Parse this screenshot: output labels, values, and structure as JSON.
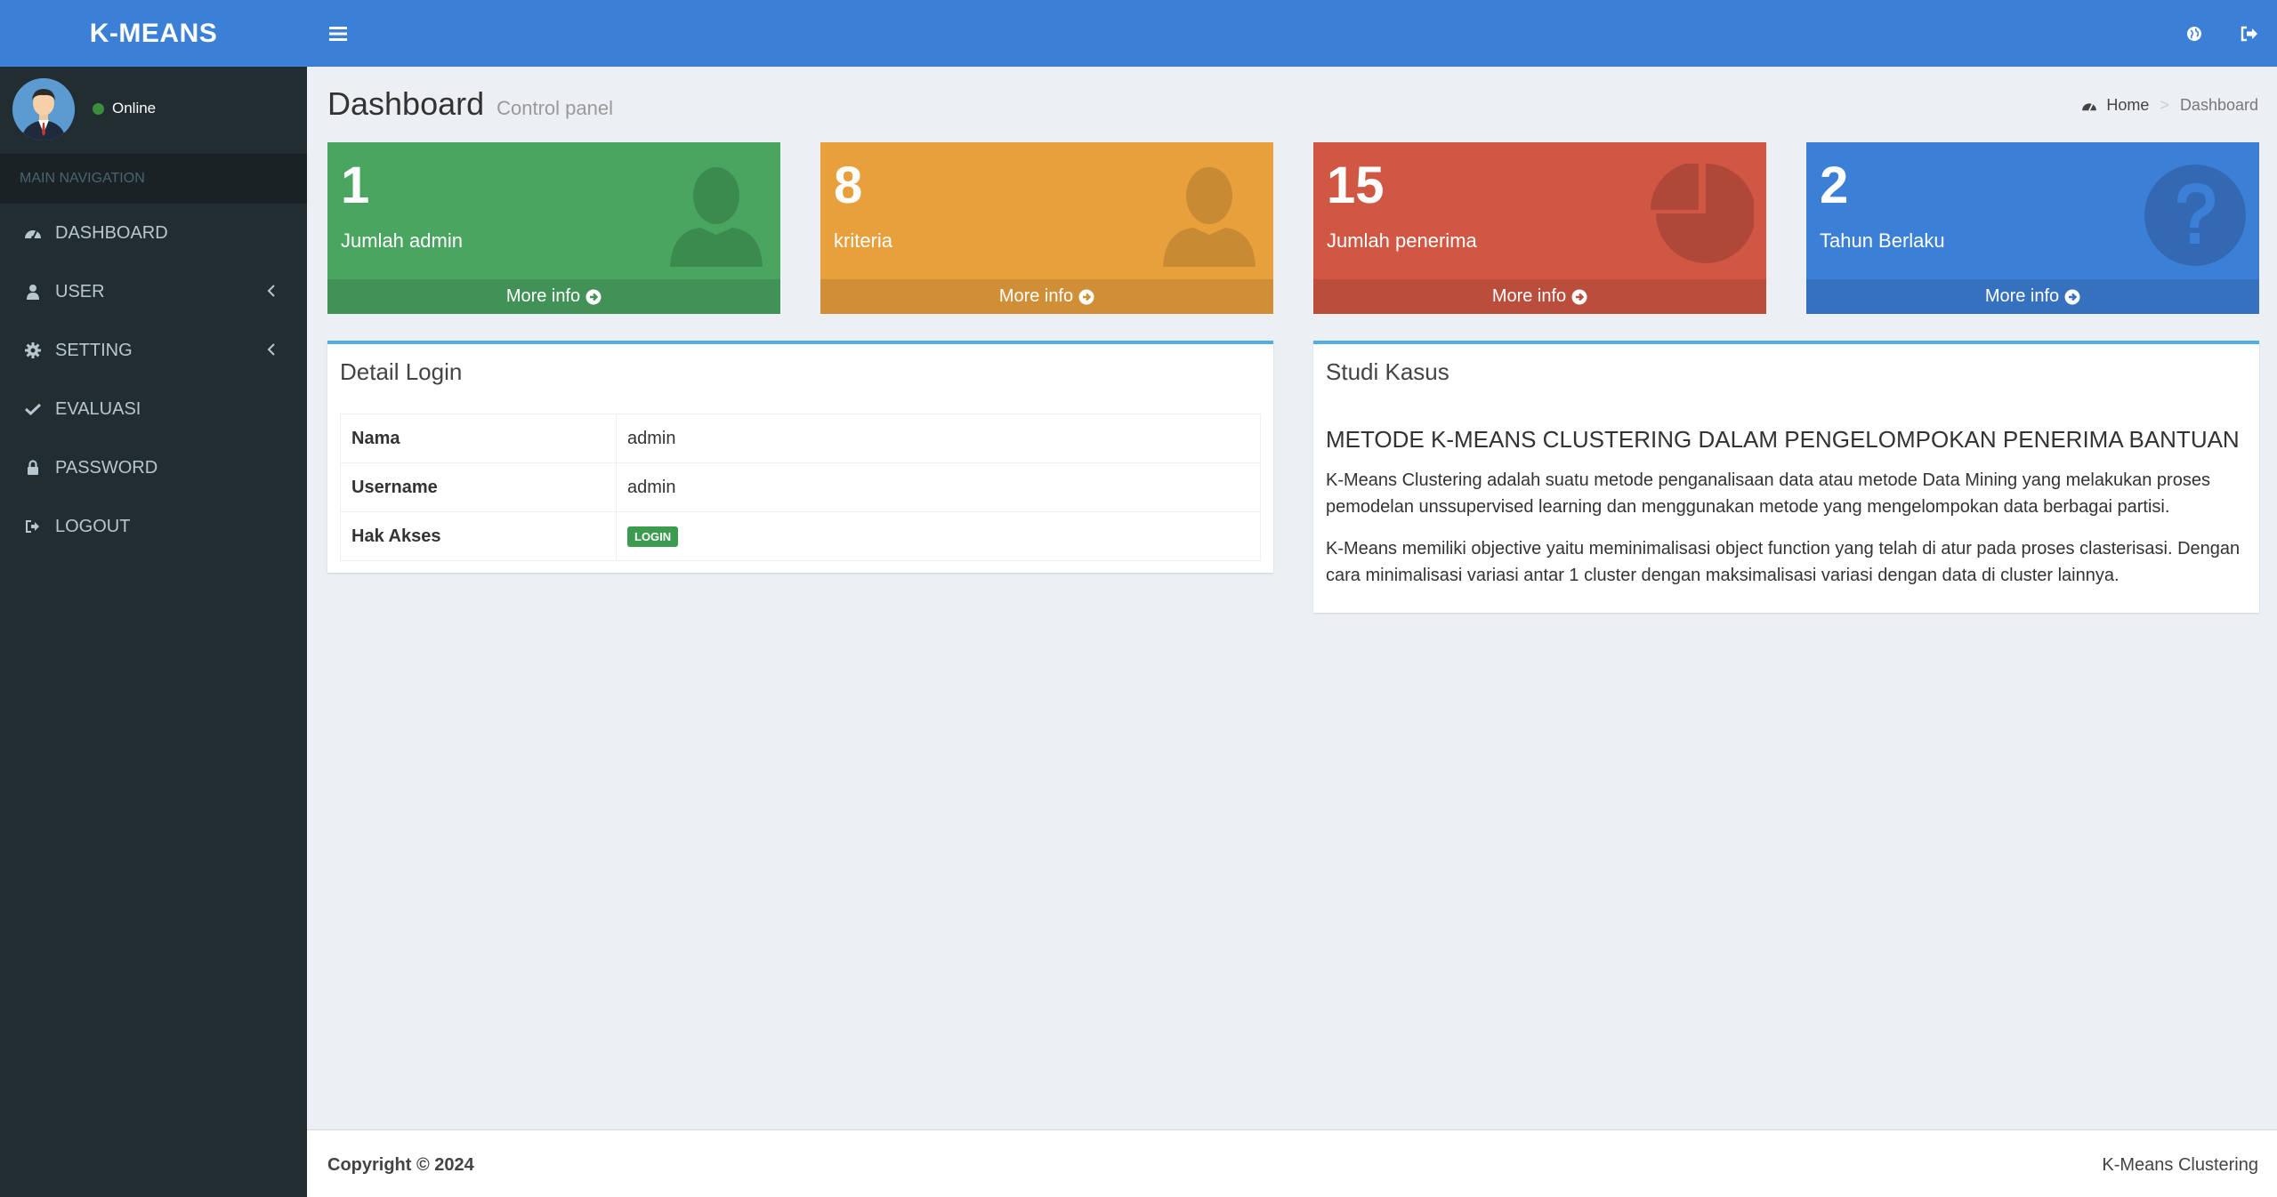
{
  "app": {
    "logo": "K-MEANS"
  },
  "user": {
    "status": "Online"
  },
  "sidebar": {
    "header": "MAIN NAVIGATION",
    "items": [
      {
        "label": "DASHBOARD",
        "icon": "dashboard-icon"
      },
      {
        "label": "USER",
        "icon": "user-icon"
      },
      {
        "label": "SETTING",
        "icon": "gear-icon"
      },
      {
        "label": "EVALUASI",
        "icon": "check-icon"
      },
      {
        "label": "PASSWORD",
        "icon": "lock-icon"
      },
      {
        "label": "LOGOUT",
        "icon": "logout-icon"
      }
    ]
  },
  "page": {
    "title": "Dashboard",
    "subtitle": "Control panel"
  },
  "breadcrumb": {
    "home": "Home",
    "current": "Dashboard"
  },
  "stats": [
    {
      "value": "1",
      "label": "Jumlah admin",
      "more": "More info",
      "color": "#4aa561"
    },
    {
      "value": "8",
      "label": "kriteria",
      "more": "More info",
      "color": "#e8a03c"
    },
    {
      "value": "15",
      "label": "Jumlah penerima",
      "more": "More info",
      "color": "#d05743"
    },
    {
      "value": "2",
      "label": "Tahun Berlaku",
      "more": "More info",
      "color": "#3c7fd6"
    }
  ],
  "login": {
    "title": "Detail Login",
    "rows": [
      {
        "key": "Nama",
        "value": "admin"
      },
      {
        "key": "Username",
        "value": "admin"
      },
      {
        "key": "Hak Akses",
        "value": "LOGIN"
      }
    ]
  },
  "study": {
    "title": "Studi Kasus",
    "heading": "METODE K-MEANS CLUSTERING DALAM PENGELOMPOKAN PENERIMA BANTUAN",
    "p1": "K-Means Clustering adalah suatu metode penganalisaan data atau metode Data Mining yang melakukan proses pemodelan unssupervised learning dan menggunakan metode yang mengelompokan data berbagai partisi.",
    "p2": "K-Means memiliki objective yaitu meminimalisasi object function yang telah di atur pada proses clasterisasi. Dengan cara minimalisasi variasi antar 1 cluster dengan maksimalisasi variasi dengan data di cluster lainnya."
  },
  "footer": {
    "copyright": "Copyright © 2024",
    "app": "K-Means Clustering"
  }
}
